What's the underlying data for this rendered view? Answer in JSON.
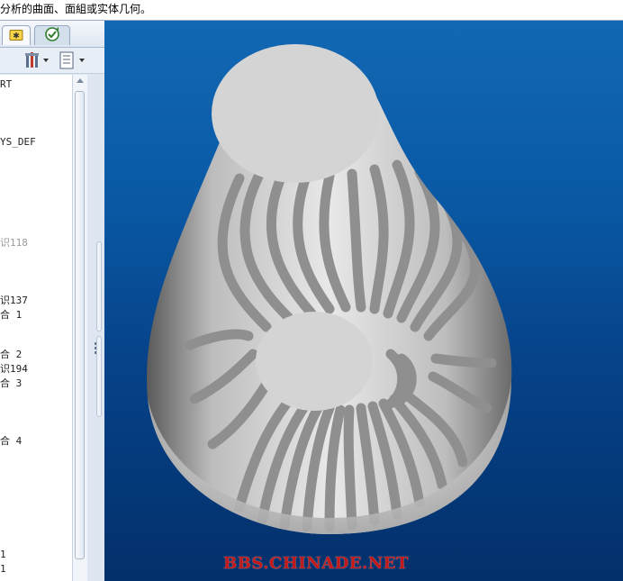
{
  "message_bar": {
    "text": "分析的曲面、面組或实体几何。"
  },
  "left_panel": {
    "tabs": [
      {
        "icon": "star-folder-icon"
      },
      {
        "icon": "refresh-check-icon"
      }
    ],
    "toolbar": [
      {
        "icon": "settings-tools-icon"
      },
      {
        "icon": "display-list-icon"
      }
    ],
    "tree": [
      {
        "text": "RT",
        "dim": false
      },
      {
        "text": "YS_DEF",
        "dim": false
      },
      {
        "text": "识118",
        "dim": true
      },
      {
        "text": "识137",
        "dim": false
      },
      {
        "text": "合 1",
        "dim": false
      },
      {
        "text": "合 2",
        "dim": false
      },
      {
        "text": "识194",
        "dim": false
      },
      {
        "text": "合 3",
        "dim": false
      },
      {
        "text": "合 4",
        "dim": false
      },
      {
        "text": "1",
        "dim": false
      },
      {
        "text": "1",
        "dim": false
      }
    ]
  },
  "viewport": {
    "watermark": "BBS.CHINADE.NET",
    "background_top": "#1268b4",
    "background_bottom": "#03306a"
  }
}
